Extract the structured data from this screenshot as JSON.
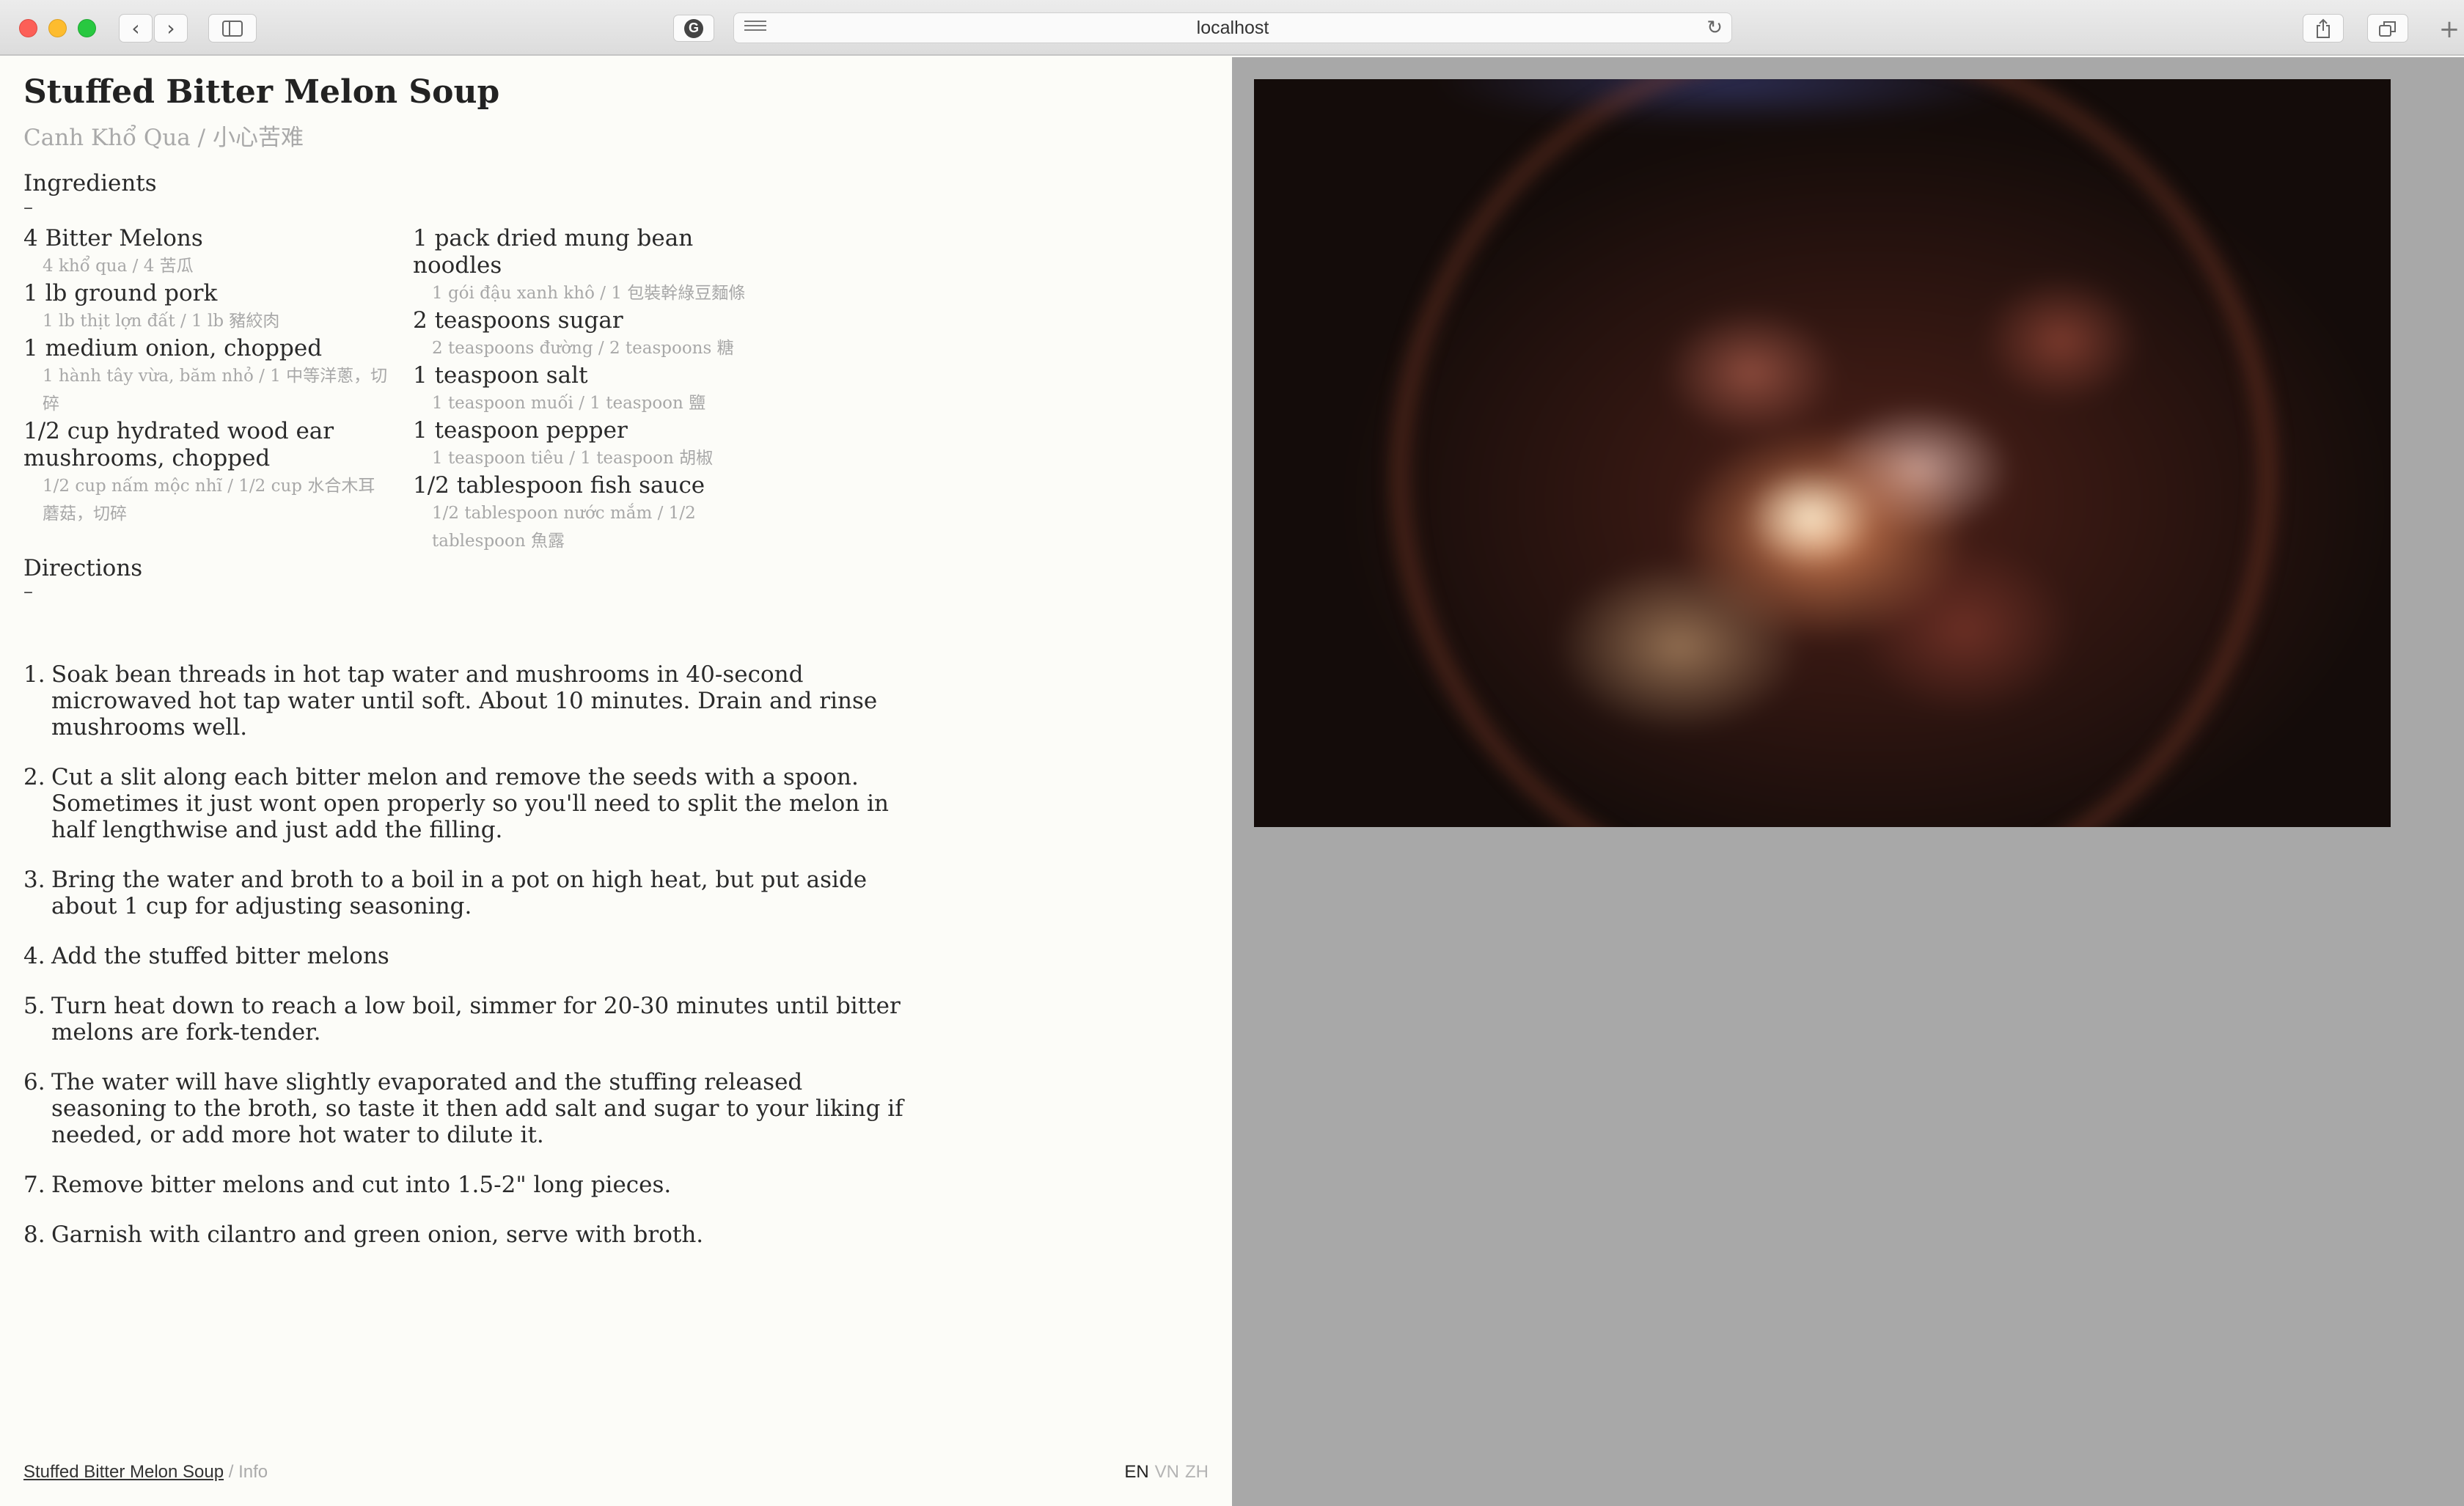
{
  "browser": {
    "url": "localhost",
    "icons": {
      "back": "chevron-left-icon",
      "forward": "chevron-right-icon",
      "sidebar": "sidebar-icon",
      "extension": "grammarly-icon",
      "reader": "reader-icon",
      "reload": "reload-icon",
      "share": "share-icon",
      "tabs": "tabs-icon",
      "new_tab": "plus-icon"
    }
  },
  "recipe": {
    "title": "Stuffed Bitter Melon Soup",
    "subtitle": "Canh Khổ Qua / 小心苦难",
    "ingredients_heading": "Ingredients",
    "directions_heading": "Directions",
    "dash": "–",
    "ingredients_col1": [
      {
        "name": "4 Bitter Melons",
        "translation": "4 khổ qua / 4 苦瓜"
      },
      {
        "name": "1 lb ground pork",
        "translation": "1 lb thịt lợn đất / 1 lb 豬絞肉"
      },
      {
        "name": "1 medium onion, chopped",
        "translation": "1 hành tây vừa, băm nhỏ / 1 中等洋蔥，切碎"
      },
      {
        "name": "1/2 cup hydrated wood ear mushrooms, chopped",
        "translation": "1/2 cup nấm mộc nhĩ / 1/2 cup 水合木耳蘑菇，切碎"
      }
    ],
    "ingredients_col2": [
      {
        "name": "1 pack dried mung bean noodles",
        "translation": "1 gói đậu xanh khô / 1 包裝幹綠豆麵條"
      },
      {
        "name": "2 teaspoons sugar",
        "translation": "2 teaspoons đường / 2 teaspoons 糖"
      },
      {
        "name": "1 teaspoon salt",
        "translation": "1 teaspoon muối / 1 teaspoon 鹽"
      },
      {
        "name": "1 teaspoon pepper",
        "translation": "1 teaspoon tiêu / 1 teaspoon 胡椒"
      },
      {
        "name": "1/2 tablespoon fish sauce",
        "translation": "1/2 tablespoon nước mắm / 1/2 tablespoon 魚露"
      }
    ],
    "directions": [
      {
        "num": "1.",
        "text": "Soak bean threads in hot tap water and mushrooms in 40-second microwaved hot tap water until soft. About 10 minutes. Drain and rinse mushrooms well."
      },
      {
        "num": "2.",
        "text": "Cut a slit along each bitter melon and remove the seeds with a spoon. Sometimes it just wont open properly so you'll need to split the melon in half lengthwise and just add the filling."
      },
      {
        "num": "3.",
        "text": "Bring the water and broth to a boil in a pot on high heat, but put aside about 1 cup for adjusting seasoning."
      },
      {
        "num": "4.",
        "text": "Add the stuffed bitter melons"
      },
      {
        "num": "5.",
        "text": "Turn heat down to reach a low boil, simmer for 20-30 minutes until bitter melons are fork-tender."
      },
      {
        "num": "6.",
        "text": "The water will have slightly evaporated and the stuffing released seasoning to the broth, so taste it then add salt and sugar to your liking if needed, or add more hot water to dilute it."
      },
      {
        "num": "7.",
        "text": "Remove bitter melons and cut into 1.5-2\" long pieces."
      },
      {
        "num": "8.",
        "text": "Garnish with cilantro and green onion, serve with broth."
      }
    ]
  },
  "footer": {
    "link": "Stuffed Bitter Melon Soup",
    "separator": " / ",
    "info": "Info",
    "languages": [
      "EN",
      "VN",
      "ZH"
    ],
    "active_language": "EN"
  },
  "colors": {
    "page_bg": "#fcfcf8",
    "panel_bg": "#a8a8a8",
    "muted_text": "#a9a9a9"
  }
}
